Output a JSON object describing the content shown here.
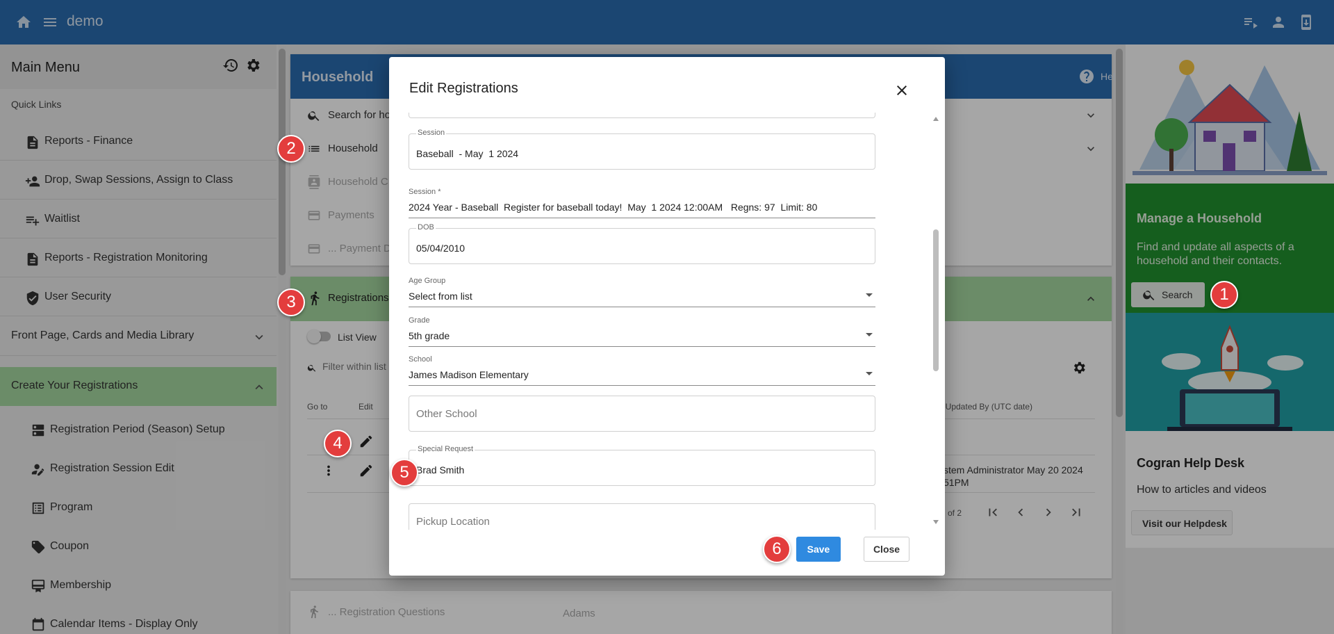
{
  "topbar": {
    "app_name": "demo",
    "home_icon": "home-icon",
    "menu_icon": "hamburger-menu-icon",
    "right_icons": [
      "playlist-icon",
      "account-icon",
      "mobile-download-icon"
    ]
  },
  "sidebar": {
    "title": "Main Menu",
    "header_icons": [
      "refresh-clock-icon",
      "gear-icon"
    ],
    "quick_links_label": "Quick Links",
    "quick_links": [
      {
        "label": "Reports - Finance",
        "icon": "document-icon"
      },
      {
        "label": "Drop, Swap Sessions, Assign to Class",
        "icon": "person-add-icon"
      },
      {
        "label": "Waitlist",
        "icon": "playlist-add-icon"
      },
      {
        "label": "Reports - Registration Monitoring",
        "icon": "document-icon"
      },
      {
        "label": "User Security",
        "icon": "shield-icon"
      }
    ],
    "sections": [
      {
        "label": "Front Page, Cards and Media Library",
        "expanded": false
      },
      {
        "label": "Create Your Registrations",
        "expanded": true
      }
    ],
    "section_items": [
      {
        "label": "Registration Period (Season) Setup",
        "icon": "dns-icon"
      },
      {
        "label": "Registration Session Edit",
        "icon": "person-edit-icon"
      },
      {
        "label": "Program",
        "icon": "list-alt-icon"
      },
      {
        "label": "Coupon",
        "icon": "tag-icon"
      },
      {
        "label": "Membership",
        "icon": "card-membership-icon"
      },
      {
        "label": "Calendar Items - Display Only",
        "icon": "calendar-icon"
      }
    ]
  },
  "main": {
    "household_title": "Household",
    "help_label": "Help",
    "rows": [
      {
        "label": "Search for ho",
        "icon": "search-icon",
        "dim": false
      },
      {
        "label": "Household",
        "icon": "list-icon",
        "dim": false
      },
      {
        "label": "Household C",
        "icon": "contact-icon",
        "dim": true
      },
      {
        "label": "Payments",
        "icon": "credit-card-icon",
        "dim": true
      },
      {
        "label": "... Payment D",
        "icon": "credit-card-icon",
        "dim": true
      }
    ],
    "registrations_label": "Registrations",
    "list_view_label": "List View",
    "filter_placeholder": "Filter within list",
    "col_goto": "Go to",
    "col_edit": "Edit",
    "col_updated": "st Updated By (UTC date)",
    "row2_updated_line1": "stem Administrator May 20 2024",
    "row2_updated_line2": "51PM",
    "pager_text": "of 2",
    "reg_questions_label": "... Registration Questions",
    "reg_questions_value": "Adams"
  },
  "right_panel": {
    "household_card": {
      "title": "Manage a Household",
      "text": "Find and update all aspects of a household and their contacts.",
      "button_label": "Search"
    },
    "help_card": {
      "title": "Cogran Help Desk",
      "subtitle": "How to articles and videos",
      "button_label": "Visit our Helpdesk"
    }
  },
  "modal": {
    "title": "Edit Registrations",
    "fields": {
      "session_box": {
        "label": "Session",
        "value": "Baseball  - May  1 2024"
      },
      "session_select": {
        "label": "Session *",
        "value": "2024 Year - Baseball  Register for baseball today!  May  1 2024 12:00AM   Regns: 97  Limit: 80"
      },
      "dob": {
        "label": "DOB",
        "value": "05/04/2010"
      },
      "age_group": {
        "label": "Age Group",
        "value": "Select from list"
      },
      "grade": {
        "label": "Grade",
        "value": "5th grade"
      },
      "school": {
        "label": "School",
        "value": "James Madison Elementary"
      },
      "other_school": {
        "placeholder": "Other School"
      },
      "special_request": {
        "label": "Special Request",
        "value": "Brad Smith"
      },
      "pickup_location": {
        "placeholder": "Pickup Location"
      }
    },
    "save_label": "Save",
    "close_label": "Close"
  },
  "callouts": [
    "1",
    "2",
    "3",
    "4",
    "5",
    "6"
  ]
}
